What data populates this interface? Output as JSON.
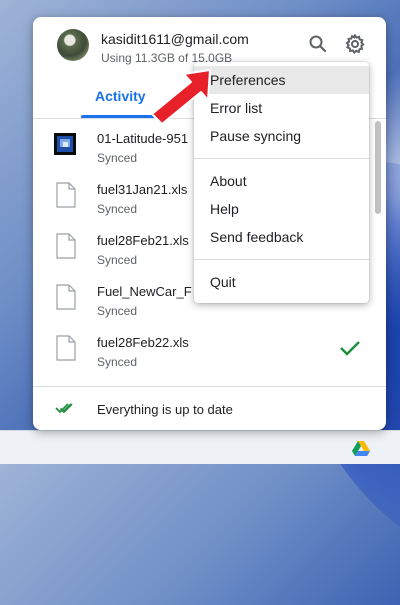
{
  "account": {
    "email": "kasidit1611@gmail.com",
    "usage": "Using 11.3GB of 15.0GB"
  },
  "header": {
    "search_icon": "search-icon",
    "settings_icon": "gear-icon"
  },
  "tabs": [
    {
      "label": "Activity",
      "active": true
    }
  ],
  "files": [
    {
      "name": "01-Latitude-951",
      "status": "Synced",
      "type": "image",
      "synced_check": false
    },
    {
      "name": "fuel31Jan21.xls",
      "status": "Synced",
      "type": "document",
      "synced_check": false
    },
    {
      "name": "fuel28Feb21.xls",
      "status": "Synced",
      "type": "document",
      "synced_check": false
    },
    {
      "name": "Fuel_NewCar_F",
      "status": "Synced",
      "type": "document",
      "synced_check": false
    },
    {
      "name": "fuel28Feb22.xls",
      "status": "Synced",
      "type": "document",
      "synced_check": true
    }
  ],
  "footer": {
    "status": "Everything is up to date"
  },
  "menu": {
    "items_group1": [
      "Preferences",
      "Error list",
      "Pause syncing"
    ],
    "items_group2": [
      "About",
      "Help",
      "Send feedback"
    ],
    "items_group3": [
      "Quit"
    ],
    "highlighted": "Preferences"
  },
  "colors": {
    "accent": "#1a73e8",
    "check": "#1e8e3e",
    "arrow": "#e8202a"
  }
}
